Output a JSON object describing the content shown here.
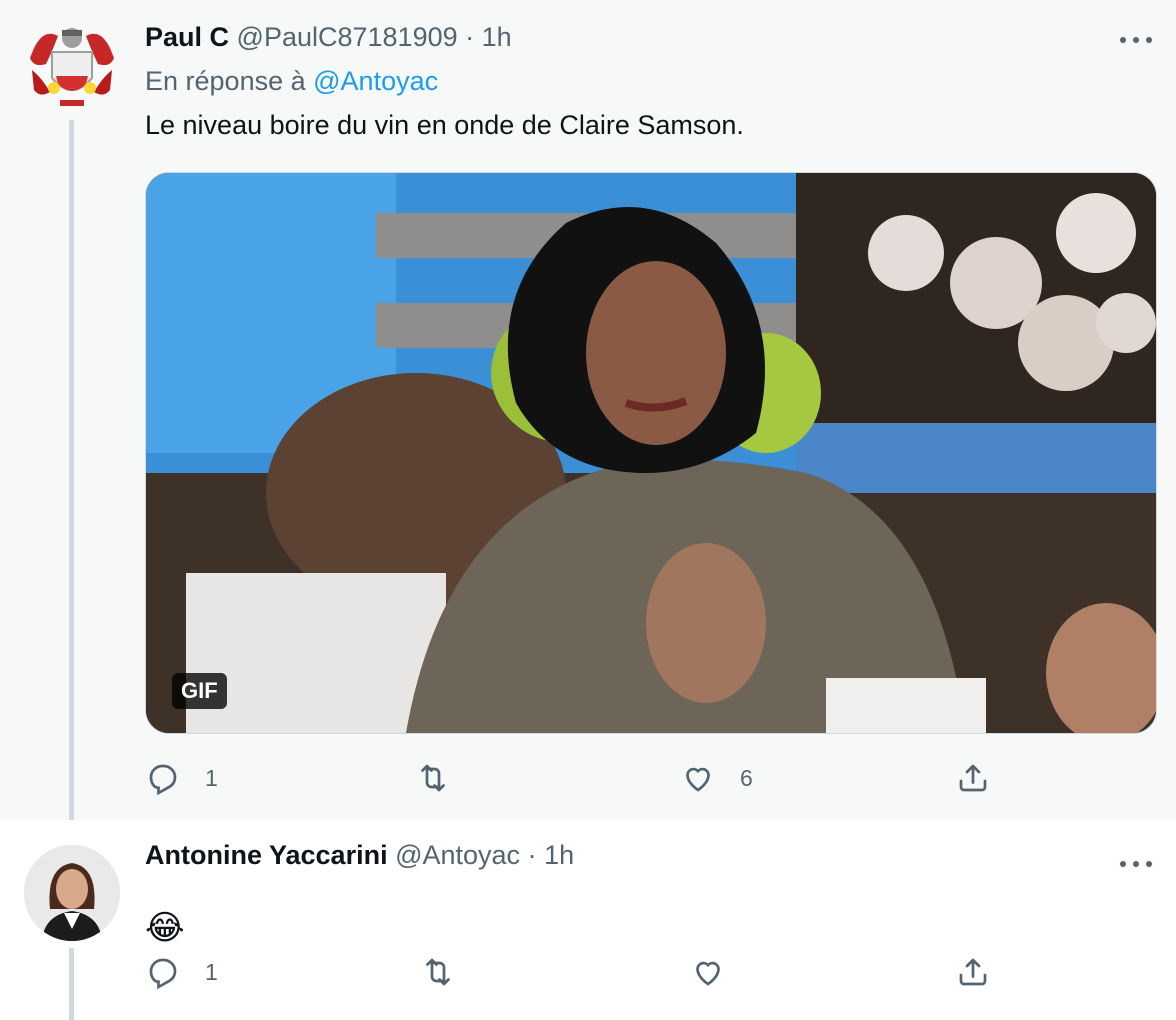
{
  "tweets": [
    {
      "name": "Paul C",
      "handle": "@PaulC87181909",
      "separator": "·",
      "time": "1h",
      "reply_prefix": "En réponse à",
      "reply_to": "@Antoyac",
      "text": "Le niveau boire du vin en onde de Claire Samson.",
      "media_badge": "GIF",
      "actions": {
        "reply_count": "1",
        "retweet_count": "",
        "like_count": "6"
      }
    },
    {
      "name": "Antonine Yaccarini",
      "handle": "@Antoyac",
      "separator": "·",
      "time": "1h",
      "text": "😂",
      "actions": {
        "reply_count": "1",
        "retweet_count": "",
        "like_count": ""
      }
    }
  ],
  "colors": {
    "accent": "#1d9bf0",
    "muted": "#536471",
    "text": "#0f1419",
    "thread_line": "#cfd9de"
  },
  "icons": [
    "reply-icon",
    "retweet-icon",
    "like-icon",
    "share-icon",
    "more-icon"
  ]
}
